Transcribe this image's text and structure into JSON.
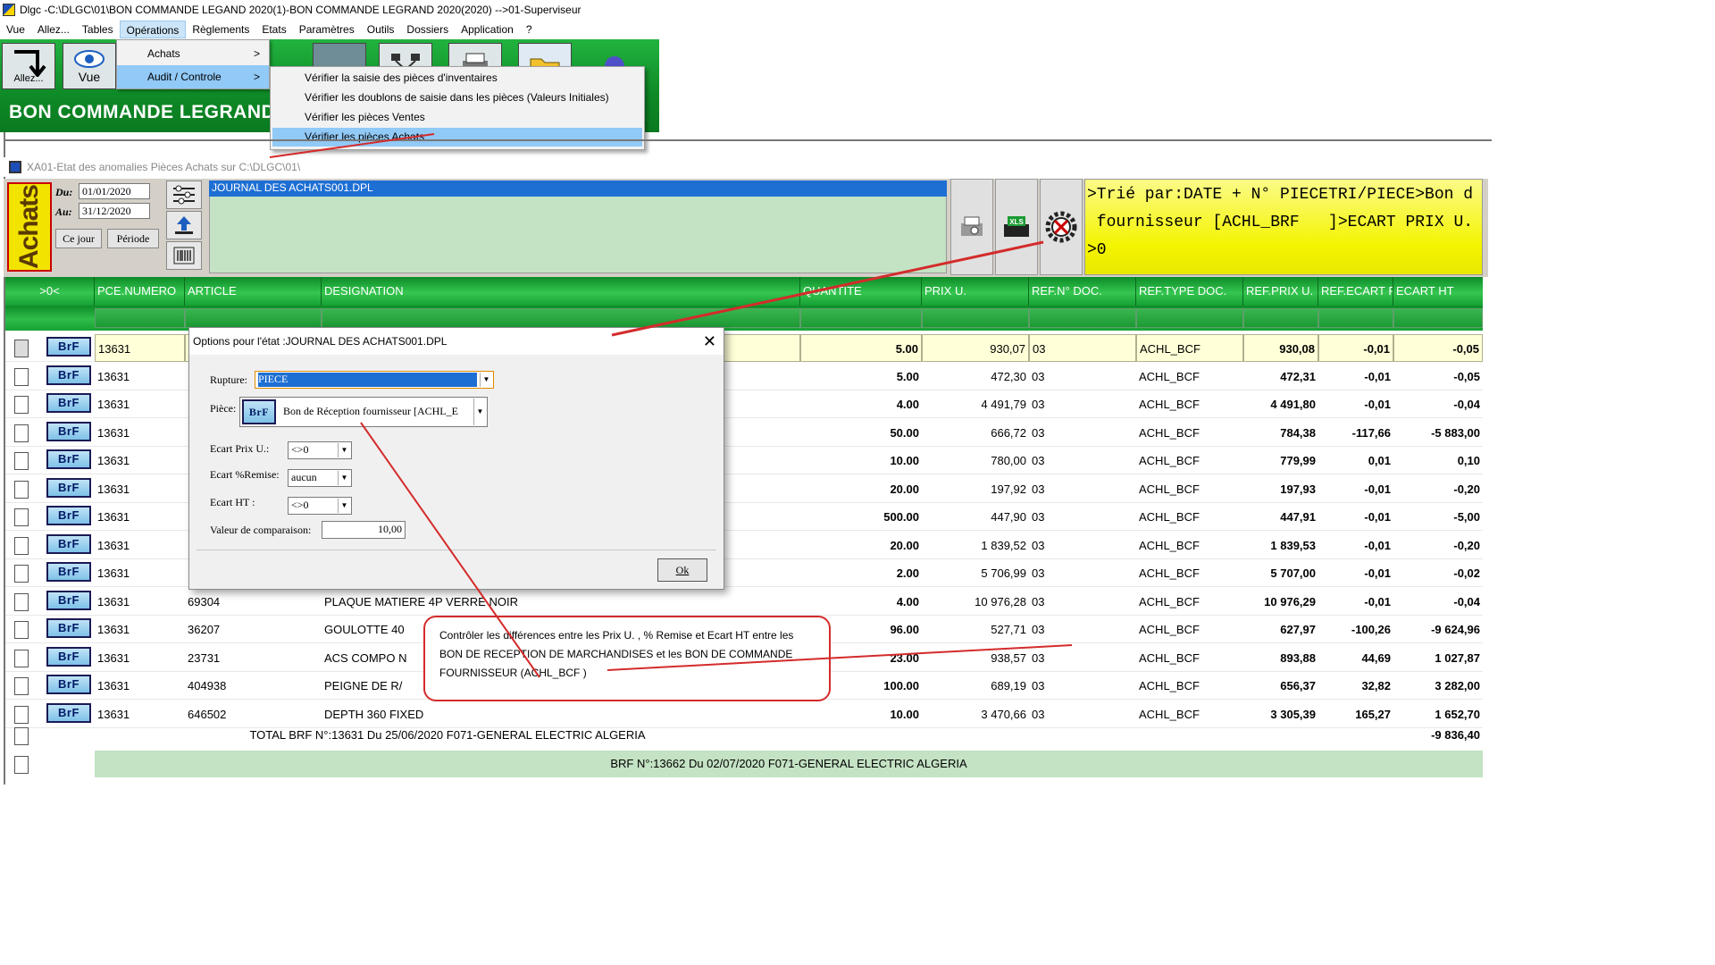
{
  "window": {
    "title": "Dlgc -C:\\DLGC\\01\\BON COMMANDE LEGAND 2020(1)-BON COMMANDE LEGRAND 2020(2020) -->01-Superviseur"
  },
  "menubar": [
    "Vue",
    "Allez...",
    "Tables",
    "Opérations",
    "Règlements",
    "Etats",
    "Paramètres",
    "Outils",
    "Dossiers",
    "Application",
    "?"
  ],
  "ribbon": {
    "allez_label": "Allez...",
    "vue_label": "Vue",
    "title": "BON COMMANDE LEGRAND"
  },
  "operations_menu": {
    "items": [
      {
        "label": "Achats",
        "arrow": ">"
      },
      {
        "label": "Audit / Controle",
        "arrow": ">"
      }
    ]
  },
  "audit_menu": {
    "items": [
      "Vérifier la saisie des pièces d'inventaires",
      "Vérifier les doublons de saisie dans les pièces (Valeurs Initiales)",
      "Vérifier les pièces Ventes",
      "Vérifier les pièces Achats"
    ]
  },
  "inner_window": {
    "title": "XA01-Etat des anomalies Pièces Achats sur C:\\DLGC\\01\\"
  },
  "header": {
    "badge": "Achats",
    "du_label": "Du:",
    "du_value": "01/01/2020",
    "au_label": "Au:",
    "au_value": "31/12/2020",
    "ce_jour": "Ce jour",
    "periode": "Période",
    "journal": "JOURNAL DES ACHATS001.DPL",
    "xls_label": "XLS",
    "sort_text": ">Trié par:DATE + N° PIECETRI/PIECE>Bon d\n fournisseur [ACHL_BRF   ]>ECART PRIX U.\n>0"
  },
  "table": {
    "columns": [
      ">0<",
      "PCE.NUMERO",
      "ARTICLE",
      "DESIGNATION",
      "QUANTITE",
      "PRIX U.",
      "REF.N° DOC.",
      "REF.TYPE DOC.",
      "REF.PRIX U.",
      "REF.ECART PRIX",
      "ECART HT"
    ],
    "badge": "BrF",
    "rows": [
      [
        "13631",
        "",
        "",
        "5.00",
        "930,07",
        "03",
        "ACHL_BCF",
        "930,08",
        "-0,01",
        "-0,05"
      ],
      [
        "13631",
        "",
        "",
        "5.00",
        "472,30",
        "03",
        "ACHL_BCF",
        "472,31",
        "-0,01",
        "-0,05"
      ],
      [
        "13631",
        "",
        "",
        "4.00",
        "4 491,79",
        "03",
        "ACHL_BCF",
        "4 491,80",
        "-0,01",
        "-0,04"
      ],
      [
        "13631",
        "",
        "",
        "50.00",
        "666,72",
        "03",
        "ACHL_BCF",
        "784,38",
        "-117,66",
        "-5 883,00"
      ],
      [
        "13631",
        "",
        "",
        "10.00",
        "780,00",
        "03",
        "ACHL_BCF",
        "779,99",
        "0,01",
        "0,10"
      ],
      [
        "13631",
        "",
        "",
        "20.00",
        "197,92",
        "03",
        "ACHL_BCF",
        "197,93",
        "-0,01",
        "-0,20"
      ],
      [
        "13631",
        "",
        "",
        "500.00",
        "447,90",
        "03",
        "ACHL_BCF",
        "447,91",
        "-0,01",
        "-5,00"
      ],
      [
        "13631",
        "",
        "",
        "20.00",
        "1 839,52",
        "03",
        "ACHL_BCF",
        "1 839,53",
        "-0,01",
        "-0,20"
      ],
      [
        "13631",
        "",
        "",
        "2.00",
        "5 706,99",
        "03",
        "ACHL_BCF",
        "5 707,00",
        "-0,01",
        "-0,02"
      ],
      [
        "13631",
        "69304",
        "PLAQUE MATIERE 4P VERRE NOIR",
        "4.00",
        "10 976,28",
        "03",
        "ACHL_BCF",
        "10 976,29",
        "-0,01",
        "-0,04"
      ],
      [
        "13631",
        "36207",
        "GOULOTTE 40",
        "96.00",
        "527,71",
        "03",
        "ACHL_BCF",
        "627,97",
        "-100,26",
        "-9 624,96"
      ],
      [
        "13631",
        "23731",
        "ACS COMPO N",
        "23.00",
        "938,57",
        "03",
        "ACHL_BCF",
        "893,88",
        "44,69",
        "1 027,87"
      ],
      [
        "13631",
        "404938",
        "PEIGNE DE R/",
        "100.00",
        "689,19",
        "03",
        "ACHL_BCF",
        "656,37",
        "32,82",
        "3 282,00"
      ],
      [
        "13631",
        "646502",
        "DEPTH 360 FIXED",
        "10.00",
        "3 470,66",
        "03",
        "ACHL_BCF",
        "3 305,39",
        "165,27",
        "1 652,70"
      ]
    ],
    "total_label": "TOTAL BRF N°:13631  Du 25/06/2020  F071-GENERAL  ELECTRIC ALGERIA",
    "total_value": "-9 836,40",
    "next_group": "BRF N°:13662  Du 02/07/2020  F071-GENERAL  ELECTRIC ALGERIA"
  },
  "dialog": {
    "title": "Options pour l'état :JOURNAL DES ACHATS001.DPL",
    "close": "✕",
    "rupture_label": "Rupture:",
    "rupture_value": "PIECE",
    "piece_label": "Pièce:",
    "piece_badge": "BrF",
    "piece_value": "Bon de Réception fournisseur [ACHL_E",
    "ecart_prix_label": "Ecart Prix U.:",
    "ecart_prix_value": "<>0",
    "ecart_remise_label": "Ecart %Remise:",
    "ecart_remise_value": "aucun",
    "ecart_ht_label": "Ecart HT :",
    "ecart_ht_value": "<>0",
    "valeur_label": "Valeur de comparaison:",
    "valeur_value": "10,00",
    "ok": "Ok"
  },
  "callout": {
    "text": "Contrôler les différences entre les Prix U. ,  % Remise  et  Ecart HT entre les BON DE RECEPTION DE MARCHANDISES et les BON DE COMMANDE FOURNISSEUR (ACHL_BCF )"
  },
  "colors": {
    "ribbon_green": "#13992e",
    "highlight_blue": "#91c9f7",
    "sort_yellow": "#f4f400",
    "annotation_red": "#d42b2b"
  }
}
